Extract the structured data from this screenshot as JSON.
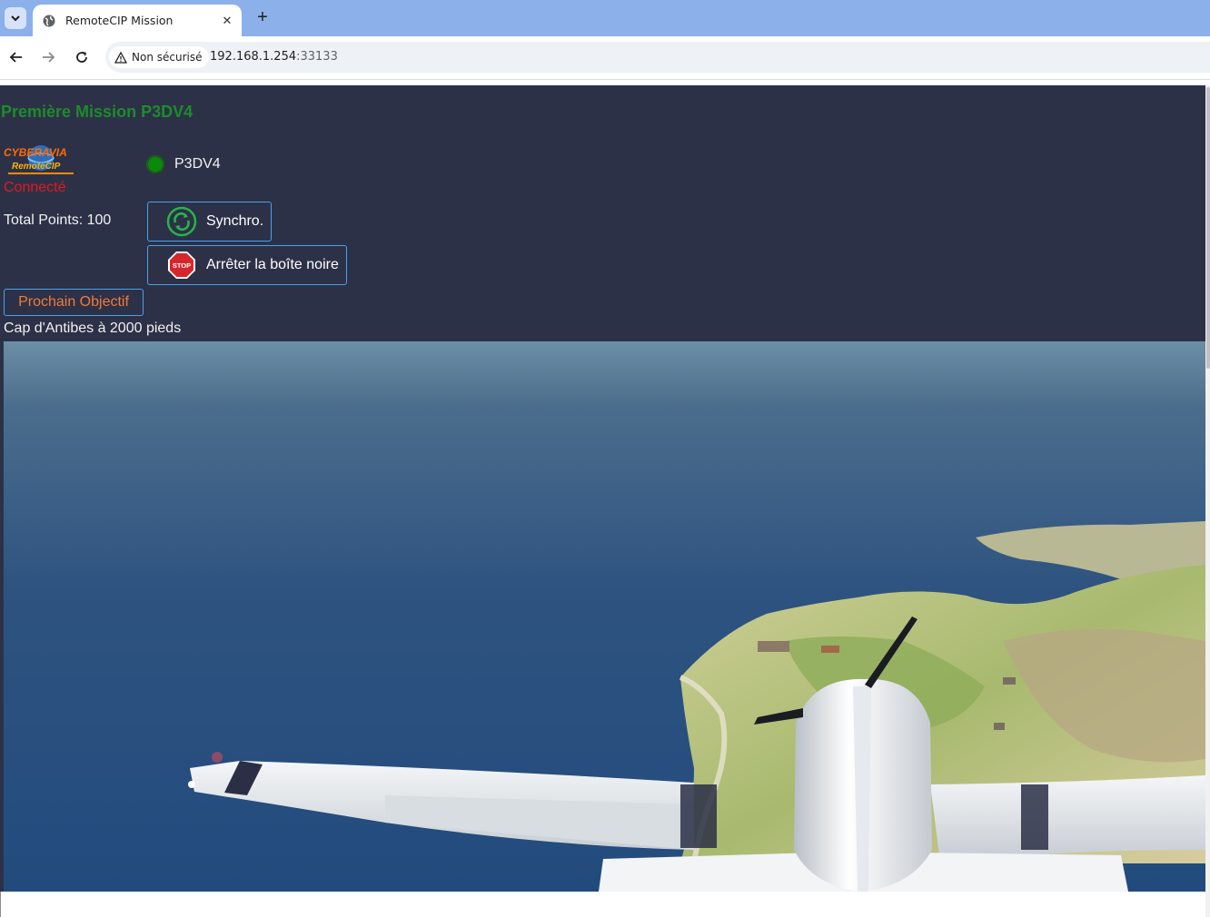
{
  "browser": {
    "tab_title": "RemoteCIP Mission",
    "security_label": "Non sécurisé",
    "url_host": "192.168.1.254",
    "url_port": ":33133"
  },
  "mission": {
    "title": "Première Mission P3DV4",
    "logo_text": "CYBERAVIA",
    "logo_subtext": "RemoteCIP",
    "connection_status": "Connecté",
    "simulator_label": "P3DV4",
    "total_points": "Total Points: 100",
    "sync_button": "Synchro.",
    "stop_button": "Arrêter la boîte noire",
    "stop_icon_text": "STOP",
    "next_objective_button": "Prochain Objectif",
    "objective_text": "Cap d'Antibes à 2000 pieds"
  },
  "colors": {
    "page_background": "#2d3148",
    "title_green": "#1c8c2a",
    "connected_red": "#e2191b",
    "status_green": "#0a8a0a",
    "button_border": "#4aa0e8",
    "next_objective_orange": "#f07a3a"
  },
  "icons": {
    "tab_list": "chevron-down-icon",
    "favicon": "globe-icon",
    "tab_close": "close-icon",
    "new_tab": "plus-icon",
    "back": "arrow-left-icon",
    "forward": "arrow-right-icon",
    "reload": "reload-icon",
    "security": "warning-icon",
    "sync": "sync-icon",
    "stop": "stop-sign-icon"
  }
}
